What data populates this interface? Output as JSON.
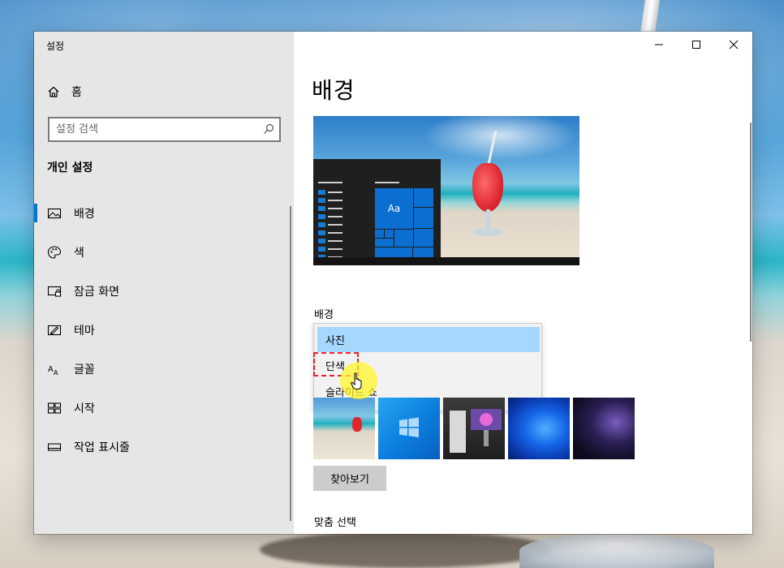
{
  "window": {
    "title": "설정"
  },
  "sidebar": {
    "home_label": "홈",
    "search": {
      "placeholder": "설정 검색",
      "value": ""
    },
    "section_title": "개인 설정",
    "items": [
      {
        "label": "배경",
        "icon": "picture-icon",
        "active": true
      },
      {
        "label": "색",
        "icon": "palette-icon",
        "active": false
      },
      {
        "label": "잠금 화면",
        "icon": "lock-screen-icon",
        "active": false
      },
      {
        "label": "테마",
        "icon": "theme-icon",
        "active": false
      },
      {
        "label": "글꼴",
        "icon": "font-icon",
        "active": false
      },
      {
        "label": "시작",
        "icon": "start-icon",
        "active": false
      },
      {
        "label": "작업 표시줄",
        "icon": "taskbar-icon",
        "active": false
      }
    ]
  },
  "main": {
    "title": "배경",
    "preview": {
      "tile_text": "Aa"
    },
    "background_label": "배경",
    "dropdown": {
      "options": [
        "사진",
        "단색",
        "슬라이드 쇼"
      ],
      "selected": "사진",
      "hovered": "단색"
    },
    "thumbnails": [
      {
        "name": "beach-drink"
      },
      {
        "name": "windows-blue"
      },
      {
        "name": "mac-pro"
      },
      {
        "name": "blue-bloom"
      },
      {
        "name": "dark-glass"
      }
    ],
    "browse_label": "찾아보기",
    "fit_label": "맞춤 선택"
  },
  "colors": {
    "accent": "#0078d7",
    "sidebar_bg": "#e6e6e6",
    "selected_option": "#a6d8ff",
    "annotation_red": "#e8202a",
    "cursor_highlight": "#fff528"
  }
}
